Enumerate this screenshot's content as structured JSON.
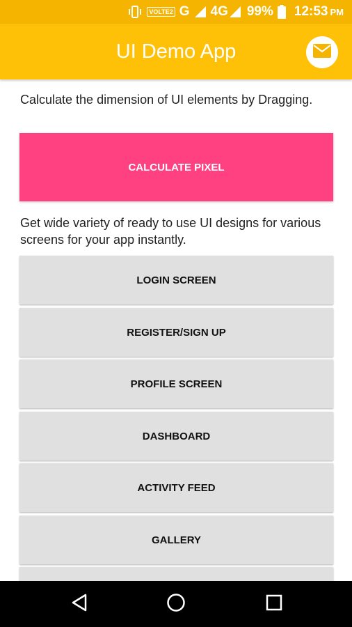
{
  "status_bar": {
    "volte": "VOLTE2",
    "network_g": "G",
    "network_4g": "4G",
    "network_4g_sub": "4G",
    "battery": "99%",
    "time": "12:53",
    "ampm": "PM"
  },
  "app_bar": {
    "title": "UI Demo App",
    "action_icon": "mail-icon"
  },
  "main": {
    "intro_text": "Calculate the dimension of UI elements by Dragging.",
    "calculate_button": "CALCULATE PIXEL",
    "designs_text": "Get wide variety of ready to use UI designs for various screens for your app instantly.",
    "screens": [
      {
        "label": "LOGIN SCREEN"
      },
      {
        "label": "REGISTER/SIGN UP"
      },
      {
        "label": "PROFILE SCREEN"
      },
      {
        "label": "DASHBOARD"
      },
      {
        "label": "ACTIVITY FEED"
      },
      {
        "label": "GALLERY"
      },
      {
        "label": ""
      }
    ]
  },
  "nav_bar": {
    "icons": [
      "back-icon",
      "home-icon",
      "recents-icon"
    ]
  },
  "colors": {
    "status_bar": "#F5B400",
    "app_bar": "#FFC107",
    "accent": "#FF4081",
    "button": "#E0E0E0"
  }
}
